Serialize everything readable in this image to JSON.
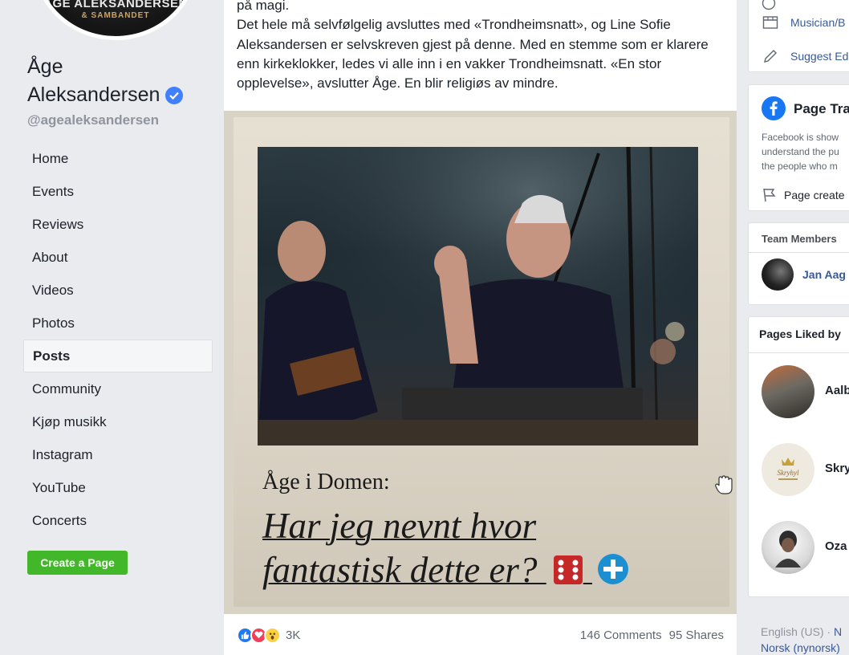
{
  "page": {
    "logo_line1": "ÅGE ALEKSANDERSEN",
    "logo_line2": "& SAMBANDET",
    "name_line1": "Åge",
    "name_line2": "Aleksandersen",
    "handle": "@agealeksandersen"
  },
  "nav": {
    "items": [
      {
        "label": "Home"
      },
      {
        "label": "Events"
      },
      {
        "label": "Reviews"
      },
      {
        "label": "About"
      },
      {
        "label": "Videos"
      },
      {
        "label": "Photos"
      },
      {
        "label": "Posts",
        "active": true
      },
      {
        "label": "Community"
      },
      {
        "label": "Kjøp musikk"
      },
      {
        "label": "Instagram"
      },
      {
        "label": "YouTube"
      },
      {
        "label": "Concerts"
      }
    ],
    "create_page": "Create a Page"
  },
  "post": {
    "para1": "på magi.",
    "para2": "Det hele må selvfølgelig avsluttes med «Trondheimsnatt», og Line Sofie Aleksandersen er selvskreven gjest på denne. Med en stemme som er klarere enn kirkeklokker, ledes vi alle inn i en vakker Trondheimsnatt. «En stor opplevelse», avslutter Åge. En blir religiøs av mindre.",
    "photo_kicker": "Åge i Domen:",
    "photo_headline": "Har jeg nevnt hvor fantastisk dette er?",
    "reactions_count": "3K",
    "comments": "146 Comments",
    "shares": "95 Shares"
  },
  "right": {
    "category": "Musician/B",
    "suggest": "Suggest Ed",
    "transparency_title": "Page Tra",
    "transparency_text1": "Facebook is show",
    "transparency_text2": "understand the pu",
    "transparency_text3": "the people who m",
    "page_created": "Page create",
    "team_title": "Team Members",
    "team_member": "Jan Aag",
    "liked_title": "Pages Liked by",
    "liked": [
      {
        "name": "Aalb"
      },
      {
        "name": "Skry"
      },
      {
        "name": "Oza"
      }
    ],
    "lang_current": "English (US) · ",
    "lang_link1": "N",
    "lang_link2": "Norsk (nynorsk)",
    "lang_sep": " "
  },
  "colors": {
    "background": "#e9ebee",
    "link": "#385898",
    "create_button": "#42b72a",
    "verified": "#4080ff",
    "facebook_blue": "#1877f2"
  }
}
